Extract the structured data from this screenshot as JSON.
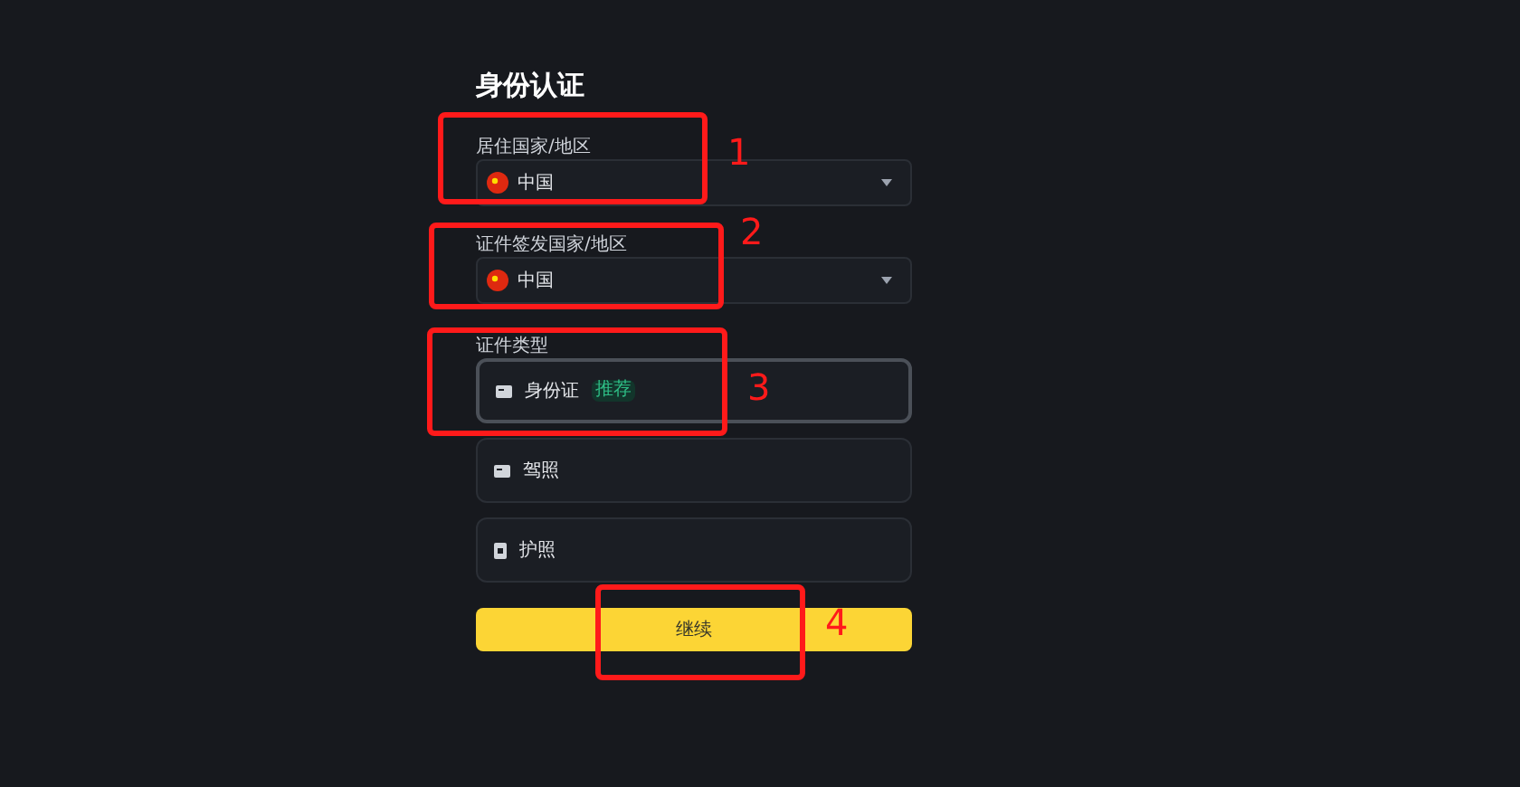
{
  "title": "身份认证",
  "selects": [
    {
      "label": "居住国家/地区",
      "value": "中国"
    },
    {
      "label": "证件签发国家/地区",
      "value": "中国"
    }
  ],
  "document_type": {
    "label": "证件类型",
    "options": [
      {
        "kind": "card",
        "label": "身份证",
        "badge": "推荐",
        "selected": true
      },
      {
        "kind": "card",
        "label": "驾照",
        "selected": false
      },
      {
        "kind": "book",
        "label": "护照",
        "selected": false
      }
    ]
  },
  "continue_button": "继续",
  "annotations": [
    {
      "label": "1"
    },
    {
      "label": "2"
    },
    {
      "label": "3"
    },
    {
      "label": "4"
    }
  ]
}
